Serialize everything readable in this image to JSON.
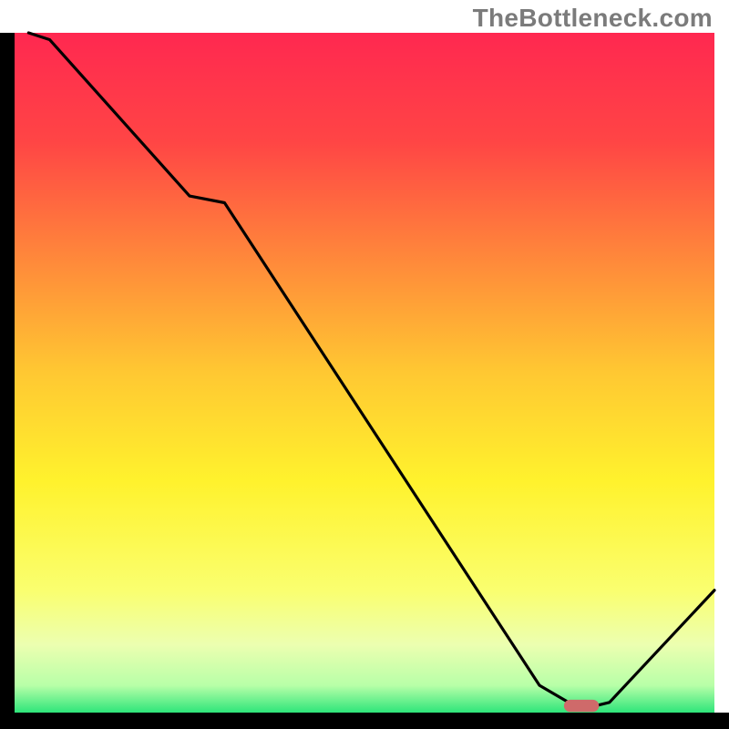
{
  "watermark": "TheBottleneck.com",
  "chart_data": {
    "type": "line",
    "title": "",
    "xlabel": "",
    "ylabel": "",
    "xlim": [
      0,
      100
    ],
    "ylim": [
      0,
      100
    ],
    "x": [
      2,
      5,
      25,
      30,
      75,
      80,
      83,
      85,
      100
    ],
    "values": [
      100,
      99,
      76,
      75,
      4,
      1,
      1,
      1.5,
      18
    ],
    "marker": {
      "x": 81,
      "y": 1,
      "width": 5,
      "height": 1.8,
      "color": "#cf6a6a"
    },
    "background_gradient": {
      "stops": [
        {
          "pct": 0,
          "color": "#ff2850"
        },
        {
          "pct": 16,
          "color": "#ff4545"
        },
        {
          "pct": 34,
          "color": "#ff8b3a"
        },
        {
          "pct": 50,
          "color": "#ffc832"
        },
        {
          "pct": 66,
          "color": "#fff22d"
        },
        {
          "pct": 82,
          "color": "#faff6f"
        },
        {
          "pct": 90,
          "color": "#ecffb0"
        },
        {
          "pct": 96,
          "color": "#b8ffa8"
        },
        {
          "pct": 100,
          "color": "#2ee57a"
        }
      ]
    },
    "axes_color": "#000000",
    "line_color": "#000000"
  }
}
